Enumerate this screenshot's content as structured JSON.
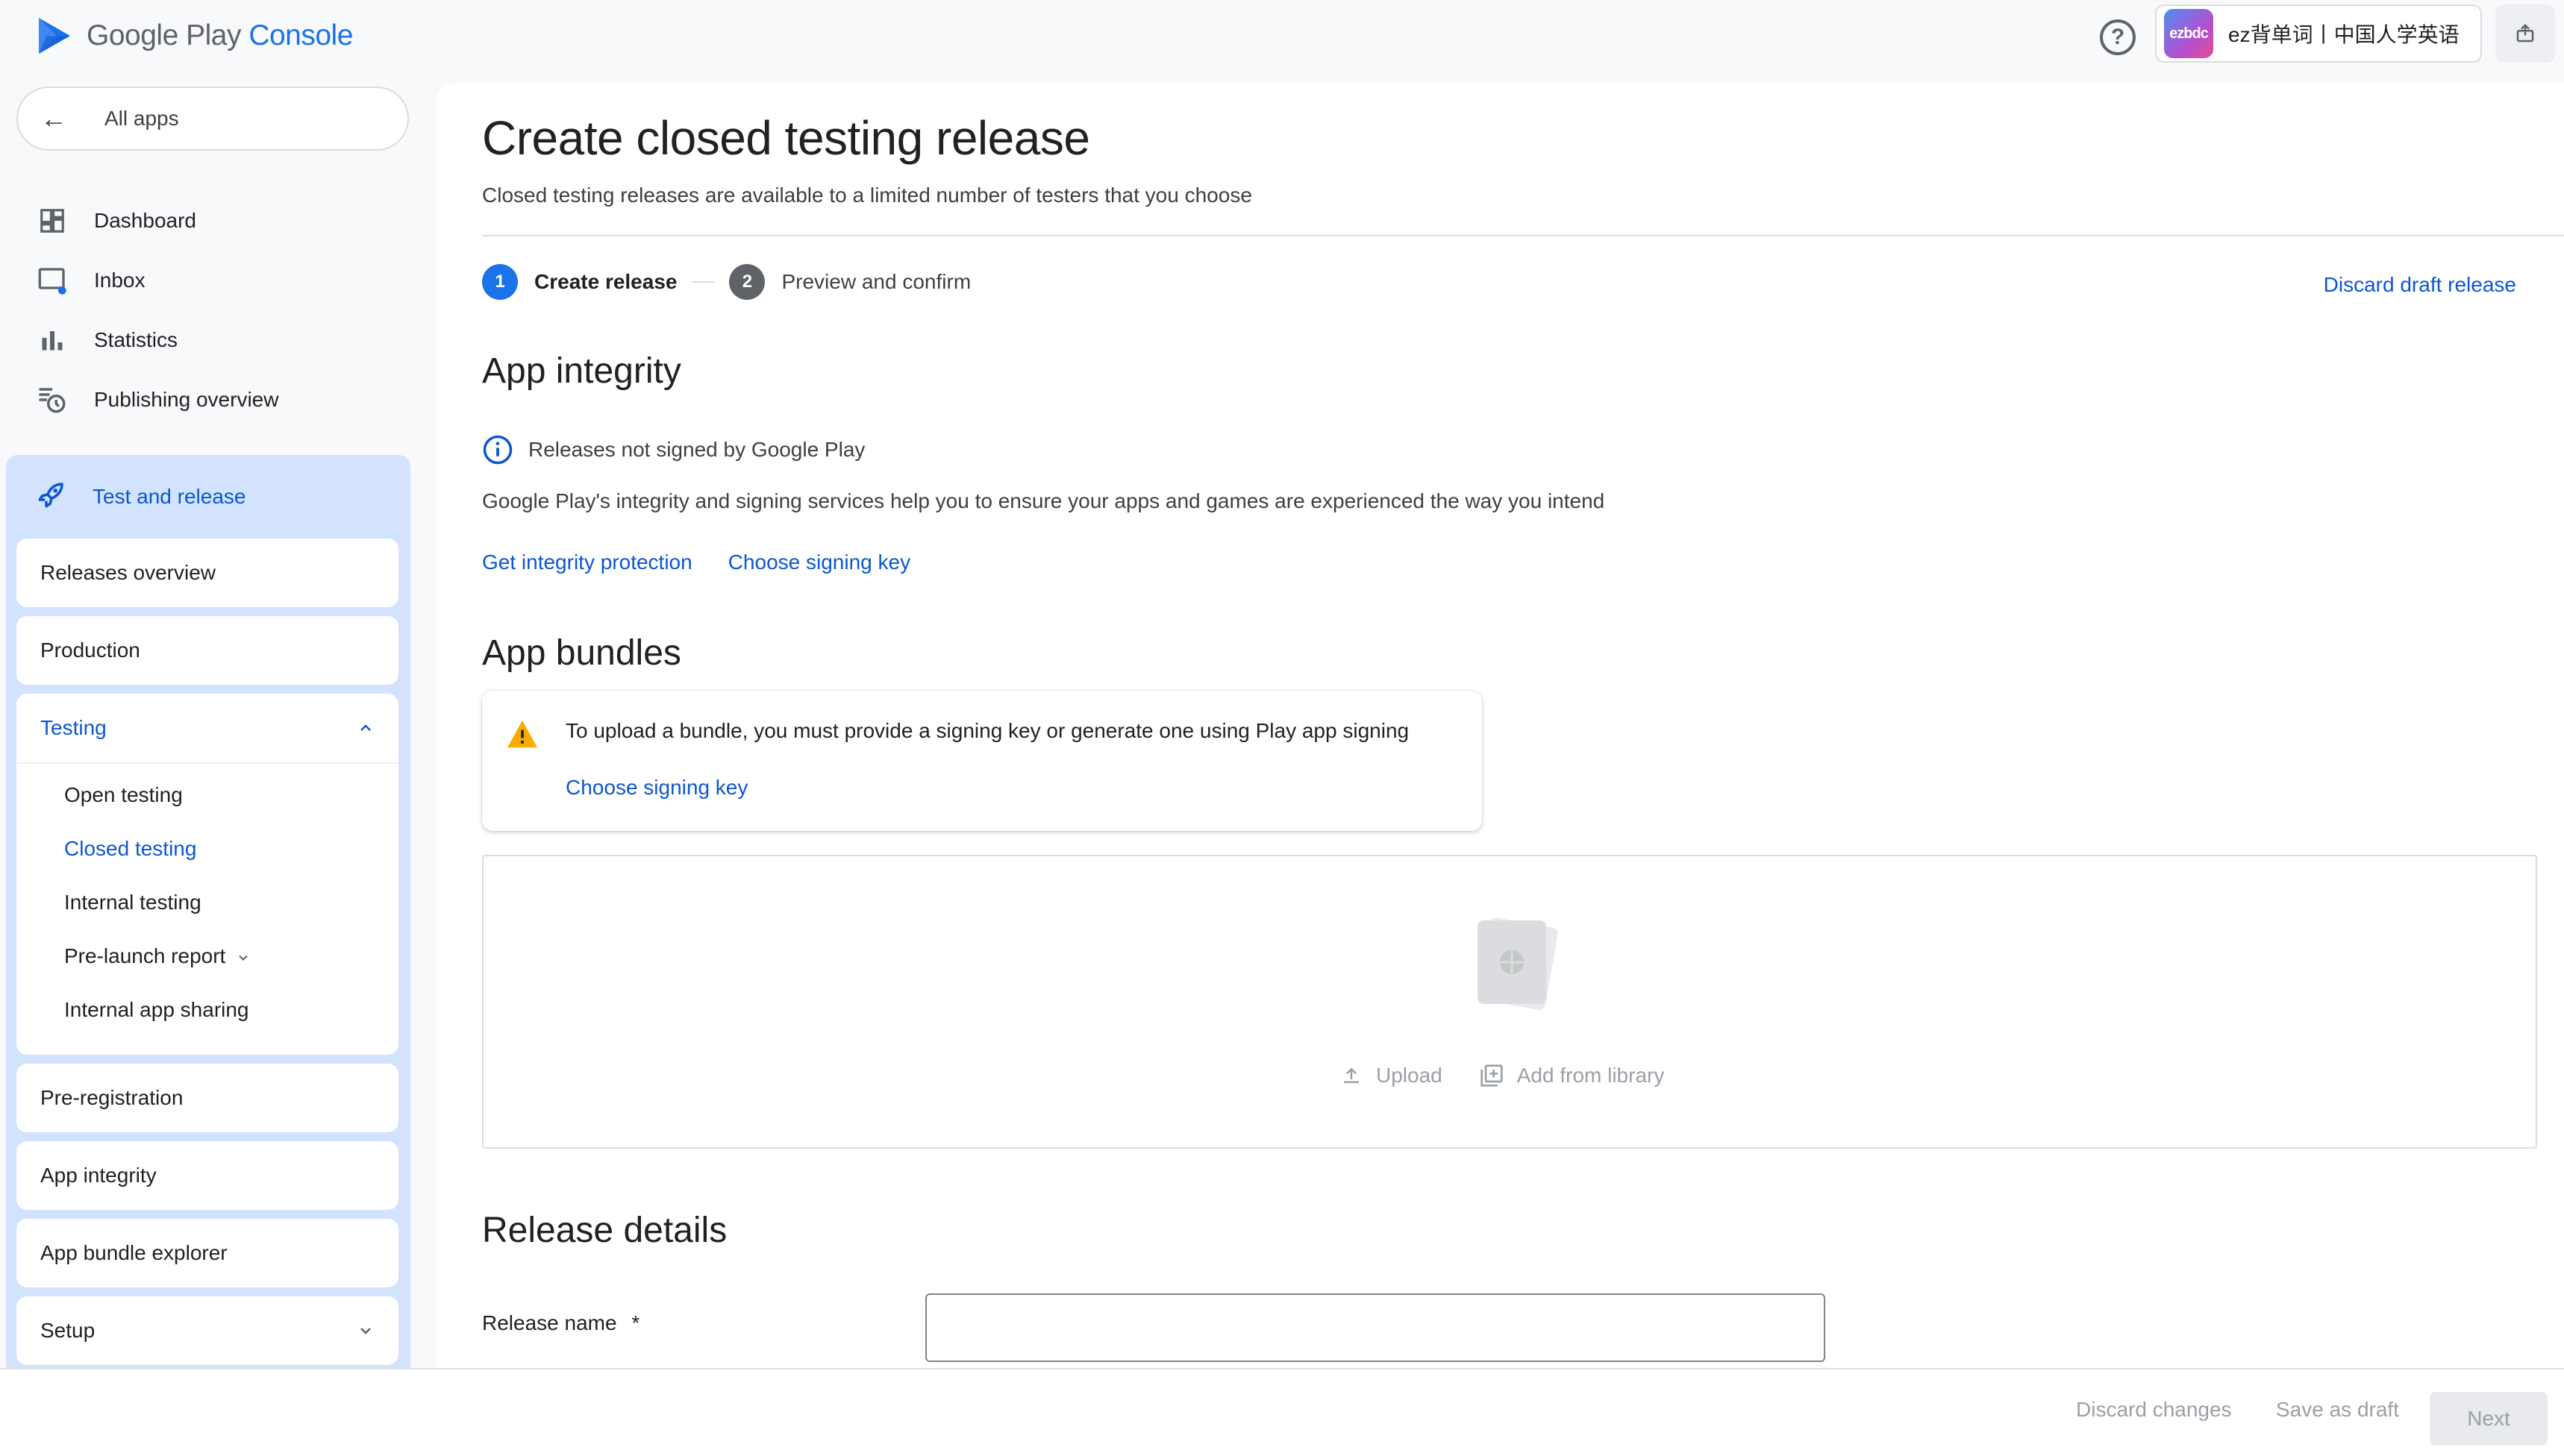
{
  "header": {
    "logo_text_main": "Google Play",
    "logo_text_console": "Console",
    "help_label": "?",
    "app_icon_text": "ezbdc",
    "account_name": "ez背单词丨中国人学英语"
  },
  "sidebar": {
    "all_apps": "All apps",
    "nav": [
      {
        "label": "Dashboard",
        "icon": "dashboard-icon"
      },
      {
        "label": "Inbox",
        "icon": "inbox-icon"
      },
      {
        "label": "Statistics",
        "icon": "bar-chart-icon"
      },
      {
        "label": "Publishing overview",
        "icon": "publishing-icon"
      }
    ],
    "section_title": "Test and release",
    "releases_overview": "Releases overview",
    "production": "Production",
    "testing": "Testing",
    "testing_items": [
      "Open testing",
      "Closed testing",
      "Internal testing",
      "Pre-launch report",
      "Internal app sharing"
    ],
    "pre_registration": "Pre-registration",
    "app_integrity": "App integrity",
    "app_bundle_explorer": "App bundle explorer",
    "setup": "Setup"
  },
  "main": {
    "title": "Create closed testing release",
    "subtitle": "Closed testing releases are available to a limited number of testers that you choose",
    "steps": [
      {
        "num": "1",
        "label": "Create release"
      },
      {
        "num": "2",
        "label": "Preview and confirm"
      }
    ],
    "discard_draft": "Discard draft release",
    "app_integrity": {
      "heading": "App integrity",
      "status": "Releases not signed by Google Play",
      "description": "Google Play's integrity and signing services help you to ensure your apps and games are experienced the way you intend",
      "link_protection": "Get integrity protection",
      "link_signing": "Choose signing key"
    },
    "app_bundles": {
      "heading": "App bundles",
      "warning": "To upload a bundle, you must provide a signing key or generate one using Play app signing",
      "warning_link": "Choose signing key",
      "upload": "Upload",
      "add_from_library": "Add from library"
    },
    "release_details": {
      "heading": "Release details",
      "release_name_label": "Release name",
      "required_mark": "*",
      "release_name_value": ""
    }
  },
  "footer": {
    "discard_changes": "Discard changes",
    "save_as_draft": "Save as draft",
    "next": "Next"
  },
  "colors": {
    "accent": "#1a73e8",
    "link": "#0b57d0",
    "sidebar_section_bg": "#d3e3fd",
    "warning": "#f9ab00"
  }
}
